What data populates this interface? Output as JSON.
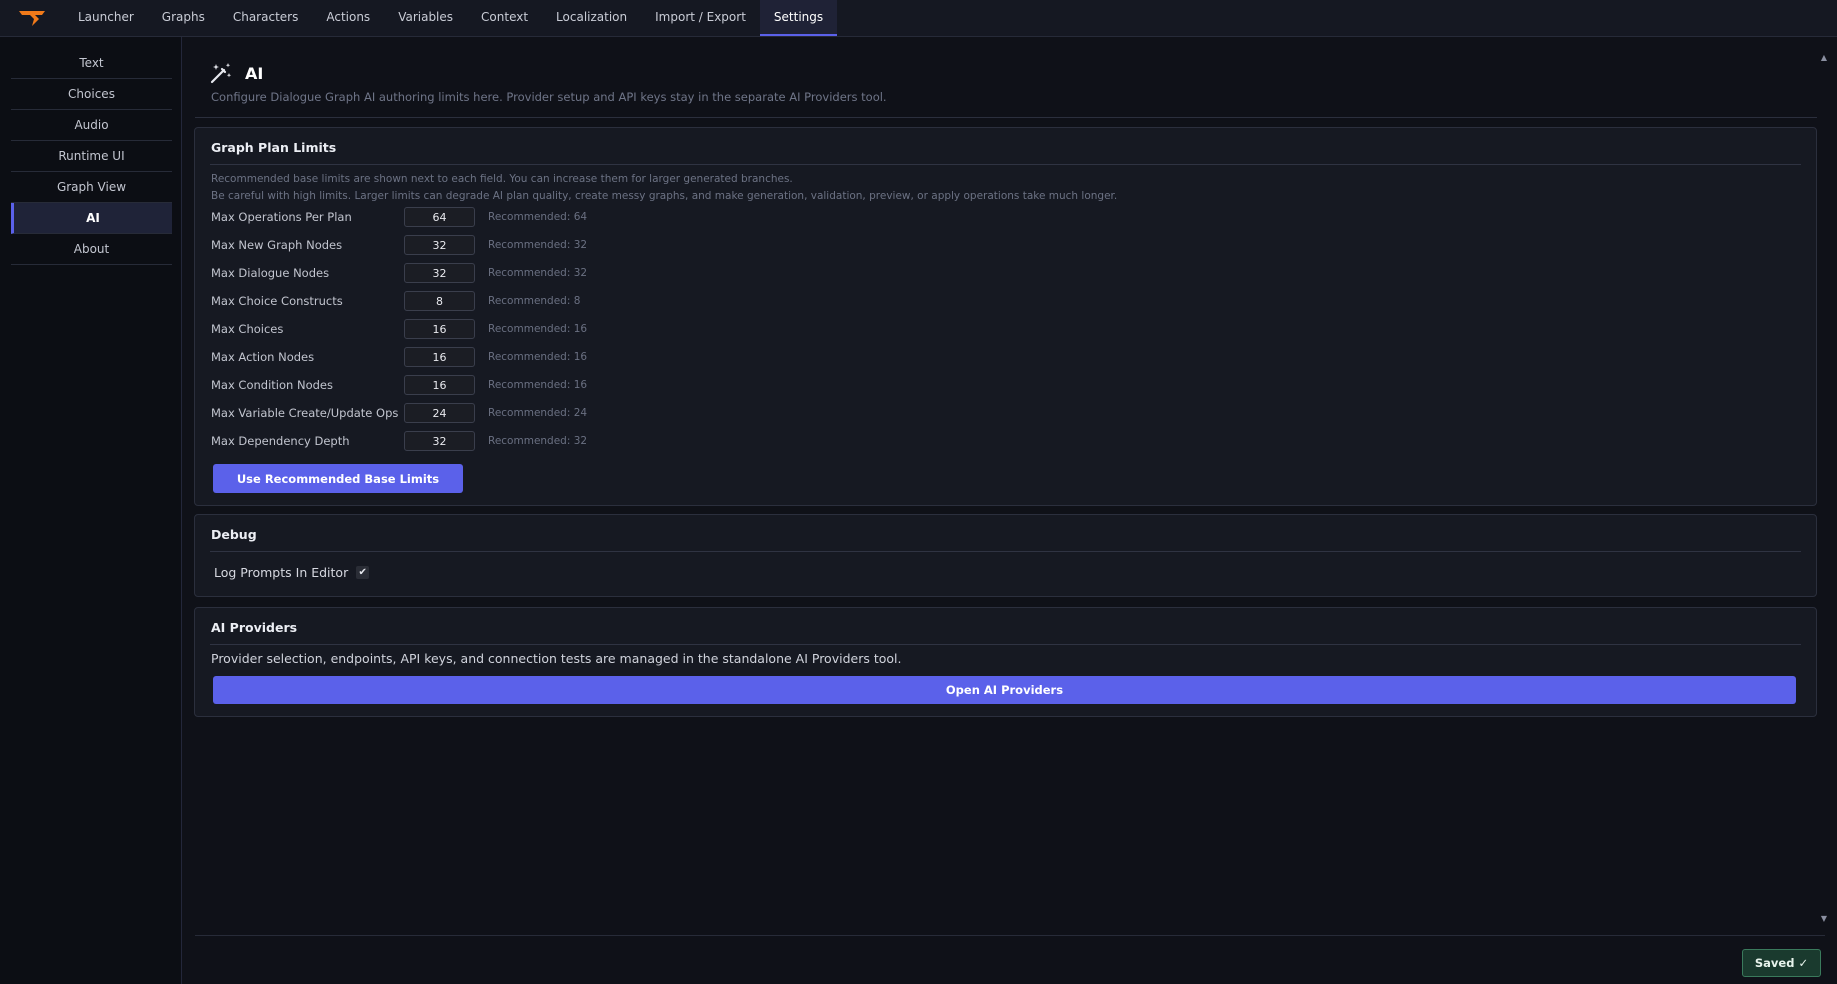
{
  "nav": {
    "tabs": [
      {
        "label": "Launcher"
      },
      {
        "label": "Graphs"
      },
      {
        "label": "Characters"
      },
      {
        "label": "Actions"
      },
      {
        "label": "Variables"
      },
      {
        "label": "Context"
      },
      {
        "label": "Localization"
      },
      {
        "label": "Import / Export"
      },
      {
        "label": "Settings",
        "active": true
      }
    ]
  },
  "sidebar": {
    "items": [
      {
        "label": "Text"
      },
      {
        "label": "Choices"
      },
      {
        "label": "Audio"
      },
      {
        "label": "Runtime UI"
      },
      {
        "label": "Graph View"
      },
      {
        "label": "AI",
        "active": true
      },
      {
        "label": "About"
      }
    ]
  },
  "header": {
    "title": "AI",
    "description": "Configure Dialogue Graph AI authoring limits here. Provider setup and API keys stay in the separate AI Providers tool."
  },
  "limits": {
    "title": "Graph Plan Limits",
    "note1": "Recommended base limits are shown next to each field. You can increase them for larger generated branches.",
    "note2": "Be careful with high limits. Larger limits can degrade AI plan quality, create messy graphs, and make generation, validation, preview, or apply operations take much longer.",
    "rows": [
      {
        "label": "Max Operations Per Plan",
        "value": "64",
        "recommended": "Recommended: 64"
      },
      {
        "label": "Max New Graph Nodes",
        "value": "32",
        "recommended": "Recommended: 32"
      },
      {
        "label": "Max Dialogue Nodes",
        "value": "32",
        "recommended": "Recommended: 32"
      },
      {
        "label": "Max Choice Constructs",
        "value": "8",
        "recommended": "Recommended: 8"
      },
      {
        "label": "Max Choices",
        "value": "16",
        "recommended": "Recommended: 16"
      },
      {
        "label": "Max Action Nodes",
        "value": "16",
        "recommended": "Recommended: 16"
      },
      {
        "label": "Max Condition Nodes",
        "value": "16",
        "recommended": "Recommended: 16"
      },
      {
        "label": "Max Variable Create/Update Ops",
        "value": "24",
        "recommended": "Recommended: 24"
      },
      {
        "label": "Max Dependency Depth",
        "value": "32",
        "recommended": "Recommended: 32"
      }
    ],
    "reset_label": "Use Recommended Base Limits"
  },
  "debug": {
    "title": "Debug",
    "log_prompts_label": "Log Prompts In Editor",
    "log_prompts_checked": true
  },
  "providers": {
    "title": "AI Providers",
    "description": "Provider selection, endpoints, API keys, and connection tests are managed in the standalone AI Providers tool.",
    "open_label": "Open AI Providers"
  },
  "footer": {
    "saved_label": "Saved ✓"
  },
  "colors": {
    "accent": "#5b61ea",
    "logo": "#f07a1a",
    "saved_bg": "#1a3a2e"
  }
}
